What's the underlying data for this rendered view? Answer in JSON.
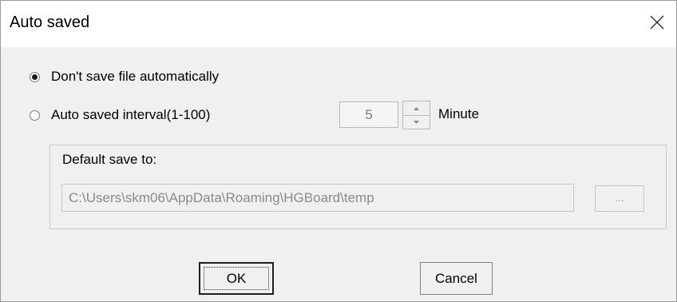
{
  "window": {
    "title": "Auto saved"
  },
  "options": {
    "dont_save_label": "Don't save file automatically",
    "interval_label": "Auto saved interval(1-100)",
    "selected": "dont_save"
  },
  "interval": {
    "value": "5",
    "unit": "Minute"
  },
  "save_location": {
    "group_label": "Default save to:",
    "path": "C:\\Users\\skm06\\AppData\\Roaming\\HGBoard\\temp",
    "browse_label": "..."
  },
  "buttons": {
    "ok_label": "OK",
    "cancel_label": "Cancel"
  },
  "icons": {
    "close": "close-icon",
    "spin_up": "chevron-up-icon",
    "spin_down": "chevron-down-icon"
  }
}
